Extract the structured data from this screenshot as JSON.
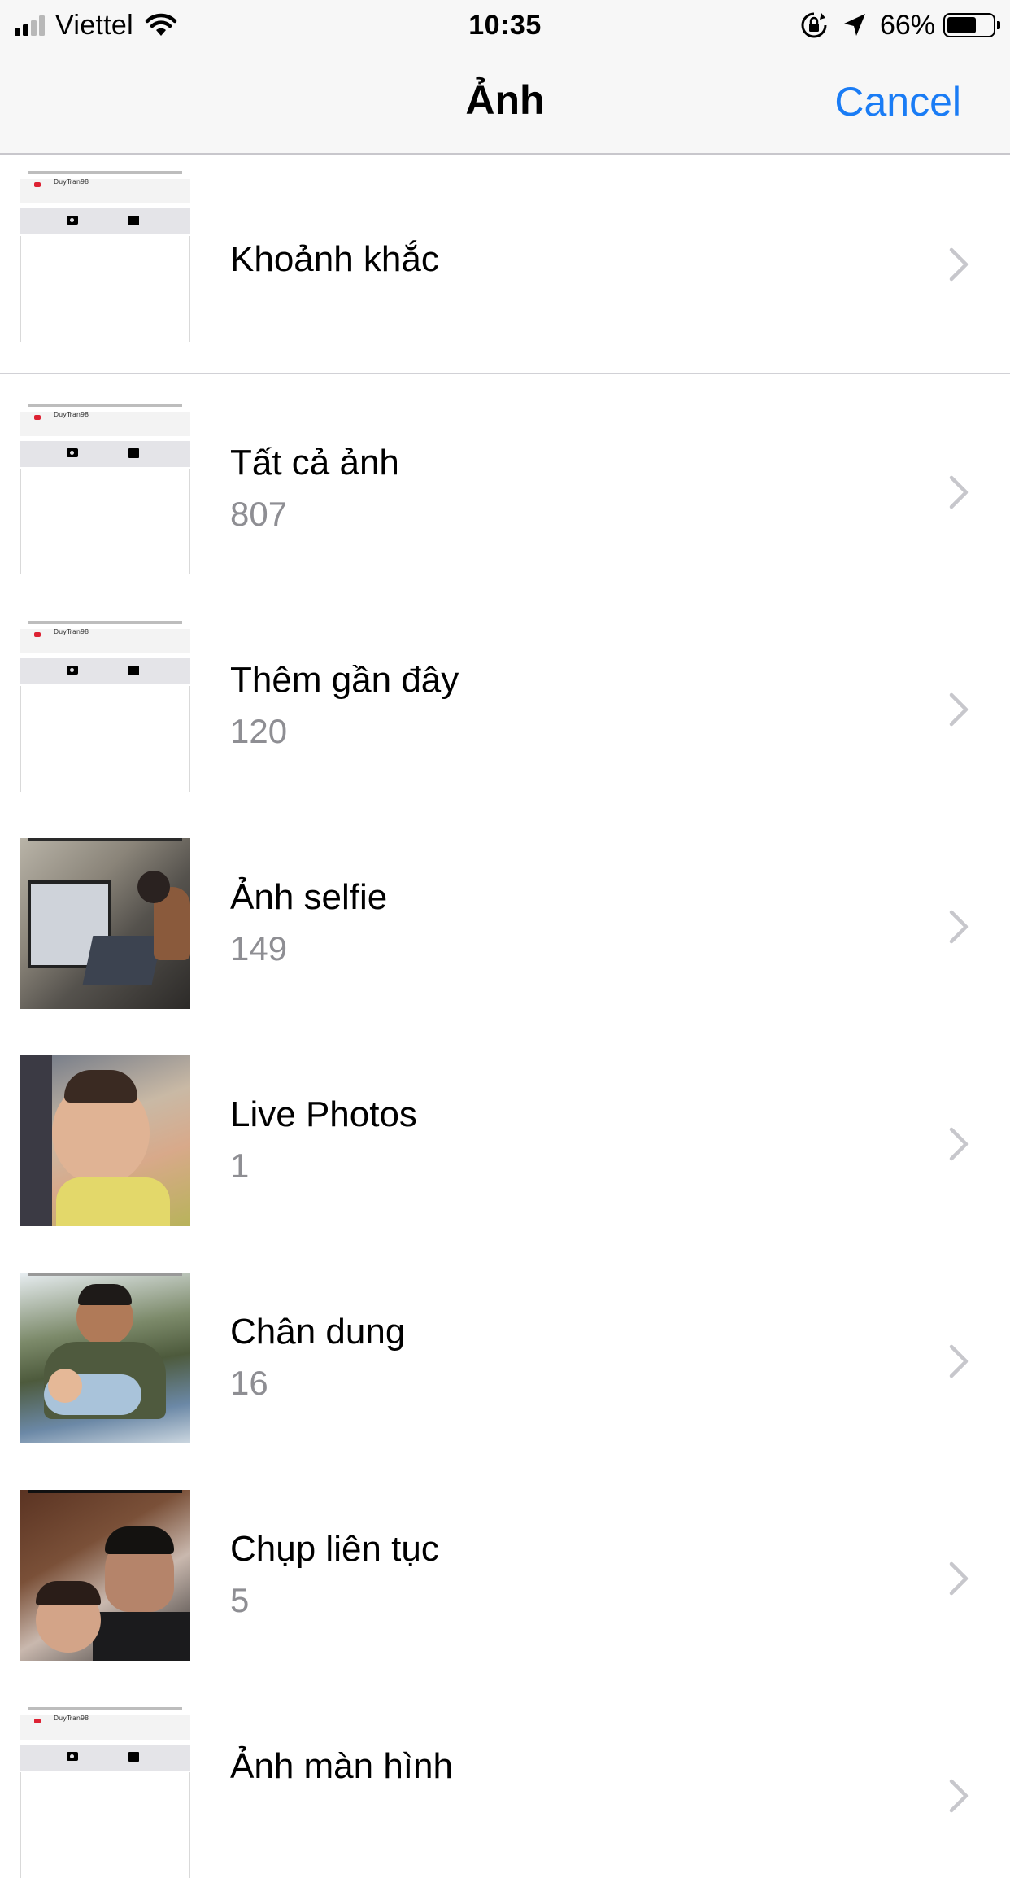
{
  "status_bar": {
    "carrier": "Viettel",
    "time": "10:35",
    "battery_percent": "66%",
    "battery_level": 0.66,
    "signal_bars_filled": 2,
    "icons": [
      "signal-icon",
      "wifi-icon",
      "rotation-lock-icon",
      "location-arrow-icon",
      "battery-icon"
    ]
  },
  "nav": {
    "title": "Ảnh",
    "cancel_label": "Cancel",
    "accent_color": "#1a7cf5"
  },
  "albums": [
    {
      "name": "Khoảnh khắc",
      "count": "",
      "thumb": "screenshot"
    },
    {
      "name": "Tất cả ảnh",
      "count": "807",
      "thumb": "screenshot"
    },
    {
      "name": "Thêm gần đây",
      "count": "120",
      "thumb": "screenshot"
    },
    {
      "name": "Ảnh selfie",
      "count": "149",
      "thumb": "photo"
    },
    {
      "name": "Live Photos",
      "count": "1",
      "thumb": "photo"
    },
    {
      "name": "Chân dung",
      "count": "16",
      "thumb": "photo"
    },
    {
      "name": "Chụp liên tục",
      "count": "5",
      "thumb": "photo"
    },
    {
      "name": "Ảnh màn hình",
      "count": "",
      "thumb": "screenshot"
    }
  ],
  "thumb_caption": "DuyTran98"
}
